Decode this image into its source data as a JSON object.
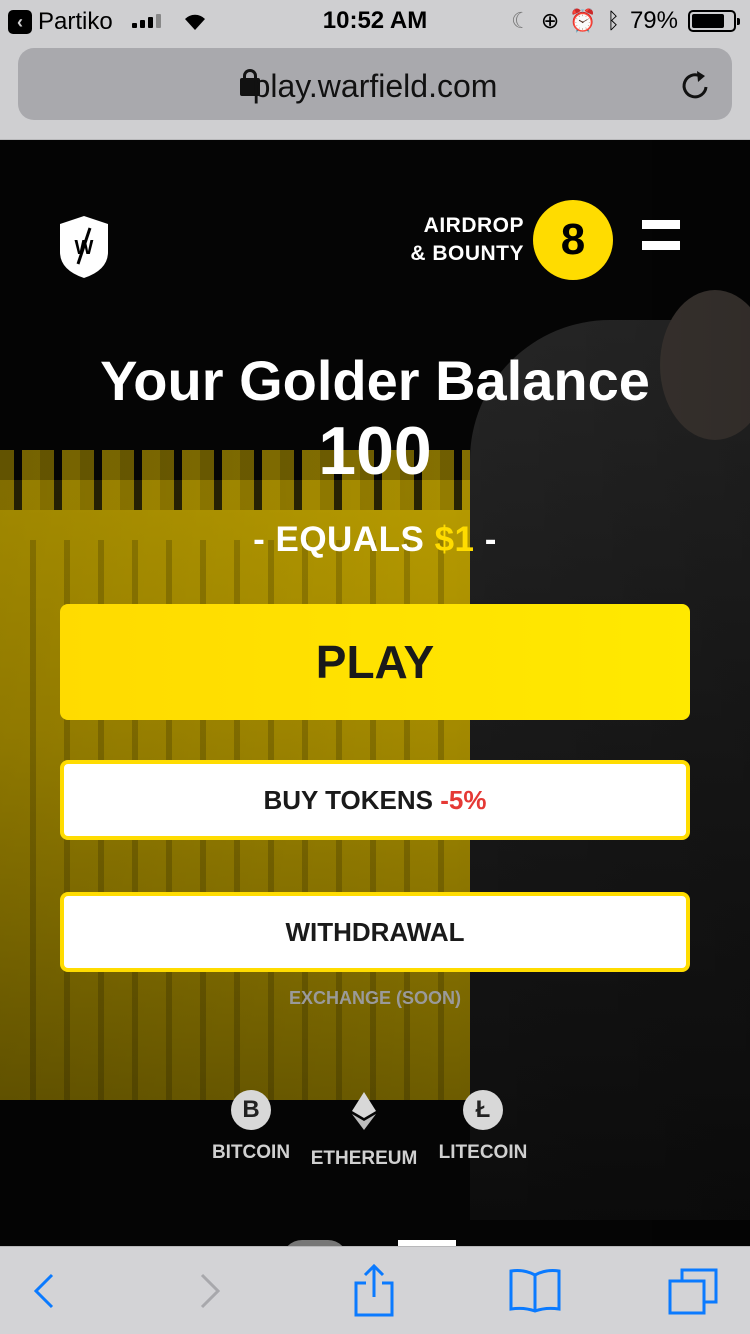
{
  "status_bar": {
    "carrier": "Partiko",
    "time": "10:52 AM",
    "battery_percent": "79%",
    "battery_level": 0.79,
    "icons": [
      "back-app-icon",
      "signal-icon",
      "wifi-icon",
      "moon-icon",
      "rotation-lock-icon",
      "alarm-icon",
      "bluetooth-icon",
      "battery-icon"
    ]
  },
  "address_bar": {
    "url": "play.warfield.com",
    "icons": [
      "lock-icon",
      "reload-icon"
    ]
  },
  "header": {
    "airdrop_line1": "AIRDROP",
    "airdrop_line2": "& BOUNTY",
    "airdrop_count": "8",
    "logo": "warfield-shield-logo",
    "menu": "hamburger-menu-icon"
  },
  "balance": {
    "title": "Your Golder Balance",
    "value": "100",
    "equals_prefix": "- EQUALS ",
    "equals_amount": "$1",
    "equals_suffix": " -"
  },
  "buttons": {
    "play": "PLAY",
    "buy_tokens": "BUY TOKENS ",
    "buy_discount": "-5%",
    "withdrawal": "WITHDRAWAL"
  },
  "exchange_label": "EXCHANGE (SOON)",
  "coins": [
    {
      "label": "BITCOIN",
      "icon": "bitcoin-icon",
      "glyph": "B"
    },
    {
      "label": "ETHEREUM",
      "icon": "ethereum-icon"
    },
    {
      "label": "LITECOIN",
      "icon": "litecoin-icon",
      "glyph": "Ł"
    }
  ],
  "toolbar": {
    "icons": [
      "back-icon",
      "forward-icon",
      "share-icon",
      "bookmarks-icon",
      "tabs-icon"
    ]
  },
  "colors": {
    "accent_yellow": "#ffdc00",
    "discount_red": "#e53935",
    "ios_blue": "#0a7aff"
  }
}
